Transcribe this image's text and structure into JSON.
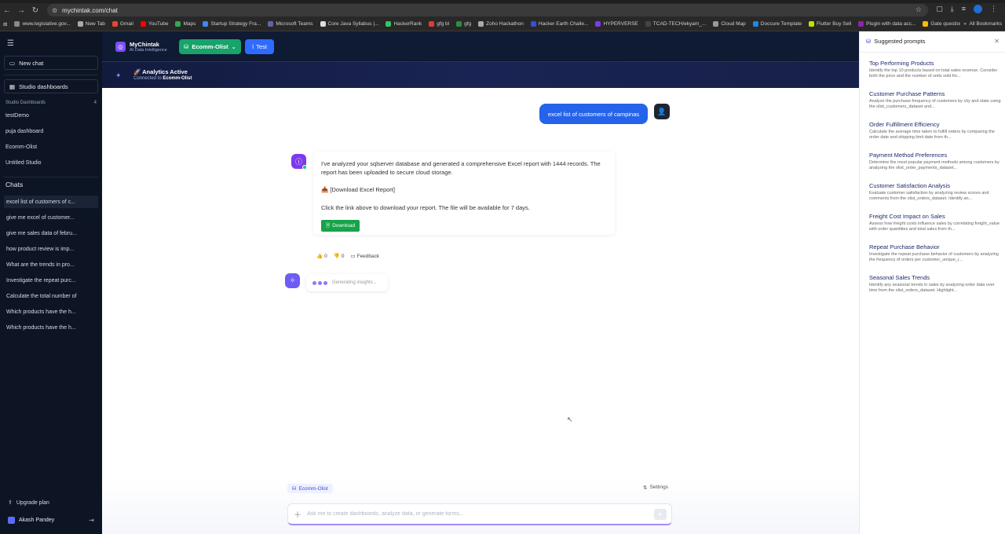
{
  "browser": {
    "url": "mychintak.com/chat",
    "bookmarks": [
      "www.legislative.gov...",
      "New Tab",
      "Gmail",
      "YouTube",
      "Maps",
      "Startup Strategy Fra...",
      "Microsoft Teams",
      "Core Java Syllabus |...",
      "HackerRank",
      "gfg bl",
      "gfg",
      "Zoho Hackathon",
      "Hacker Earth Challe...",
      "HYPERVERSE",
      "TCAD-TECH/ekyam_...",
      "Cloud Map",
      "Doccure Template",
      "Flutter Buy Sell",
      "Plugin with data acc...",
      "Gate questions"
    ],
    "all_bookmarks": "All Bookmarks"
  },
  "sidebar": {
    "new_chat": "New chat",
    "studio_dashboards_btn": "Studio dashboards",
    "section_label": "Studio Dashboards",
    "section_count": "4",
    "dashboards": [
      "testDemo",
      "puja dashboard",
      "Ecomm-Olist",
      "Untitled Studio"
    ],
    "chats_title": "Chats",
    "chats": [
      "excel list of customers of c...",
      "give me excel of customer...",
      "give me sales data of febru...",
      "how product review is imp...",
      "What are the trends in pro...",
      "Investigate the repeat purc...",
      "Calculate the total number of",
      "Which products have the h...",
      "Which products have the h..."
    ],
    "upgrade": "Upgrade plan",
    "user_name": "Akash Pandey"
  },
  "header": {
    "brand": "MyChintak",
    "brand_sub": "AI Data Intelligence",
    "db_pill": "Ecomm-Olist",
    "test_pill": "Test",
    "status_title": "🚀 Analytics Active",
    "status_prefix": "Connected to",
    "status_db": "Ecomm-Olist"
  },
  "chat": {
    "user_message": "excel list of customers of campinas",
    "bot_p1": "I've analyzed your sqlserver database and generated a comprehensive Excel report with 1444 records. The report has been uploaded to secure cloud storage.",
    "bot_link": "📥 [Download Excel Report]",
    "bot_p2": "Click the link above to download your report. The file will be available for 7 days.",
    "download_label": "Download",
    "likes": "0",
    "dislikes": "0",
    "feedback_label": "Feedback",
    "generating": "Generating insights..."
  },
  "composer": {
    "db_chip": "Ecomm-Olist",
    "settings": "Settings",
    "placeholder": "Ask me to create dashboards, analyze data, or generate forms..."
  },
  "panel": {
    "title": "Suggested prompts",
    "prompts": [
      {
        "title": "Top Performing Products",
        "desc": "Identify the top 10 products based on total sales revenue. Consider both the price and the number of units sold fro..."
      },
      {
        "title": "Customer Purchase Patterns",
        "desc": "Analyze the purchase frequency of customers by city and state using the olist_customers_dataset and..."
      },
      {
        "title": "Order Fulfillment Efficiency",
        "desc": "Calculate the average time taken to fulfill orders by comparing the order date and shipping limit date from th..."
      },
      {
        "title": "Payment Method Preferences",
        "desc": "Determine the most popular payment methods among customers by analyzing the olist_order_payments_dataset..."
      },
      {
        "title": "Customer Satisfaction Analysis",
        "desc": "Evaluate customer satisfaction by analyzing review scores and comments from the olist_orders_dataset. Identify an..."
      },
      {
        "title": "Freight Cost Impact on Sales",
        "desc": "Assess how freight costs influence sales by correlating freight_value with order quantities and total sales from th..."
      },
      {
        "title": "Repeat Purchase Behavior",
        "desc": "Investigate the repeat purchase behavior of customers by analyzing the frequency of orders per customer_unique_i..."
      },
      {
        "title": "Seasonal Sales Trends",
        "desc": "Identify any seasonal trends in sales by analyzing order data over time from the olist_orders_dataset. Highlight..."
      }
    ]
  }
}
